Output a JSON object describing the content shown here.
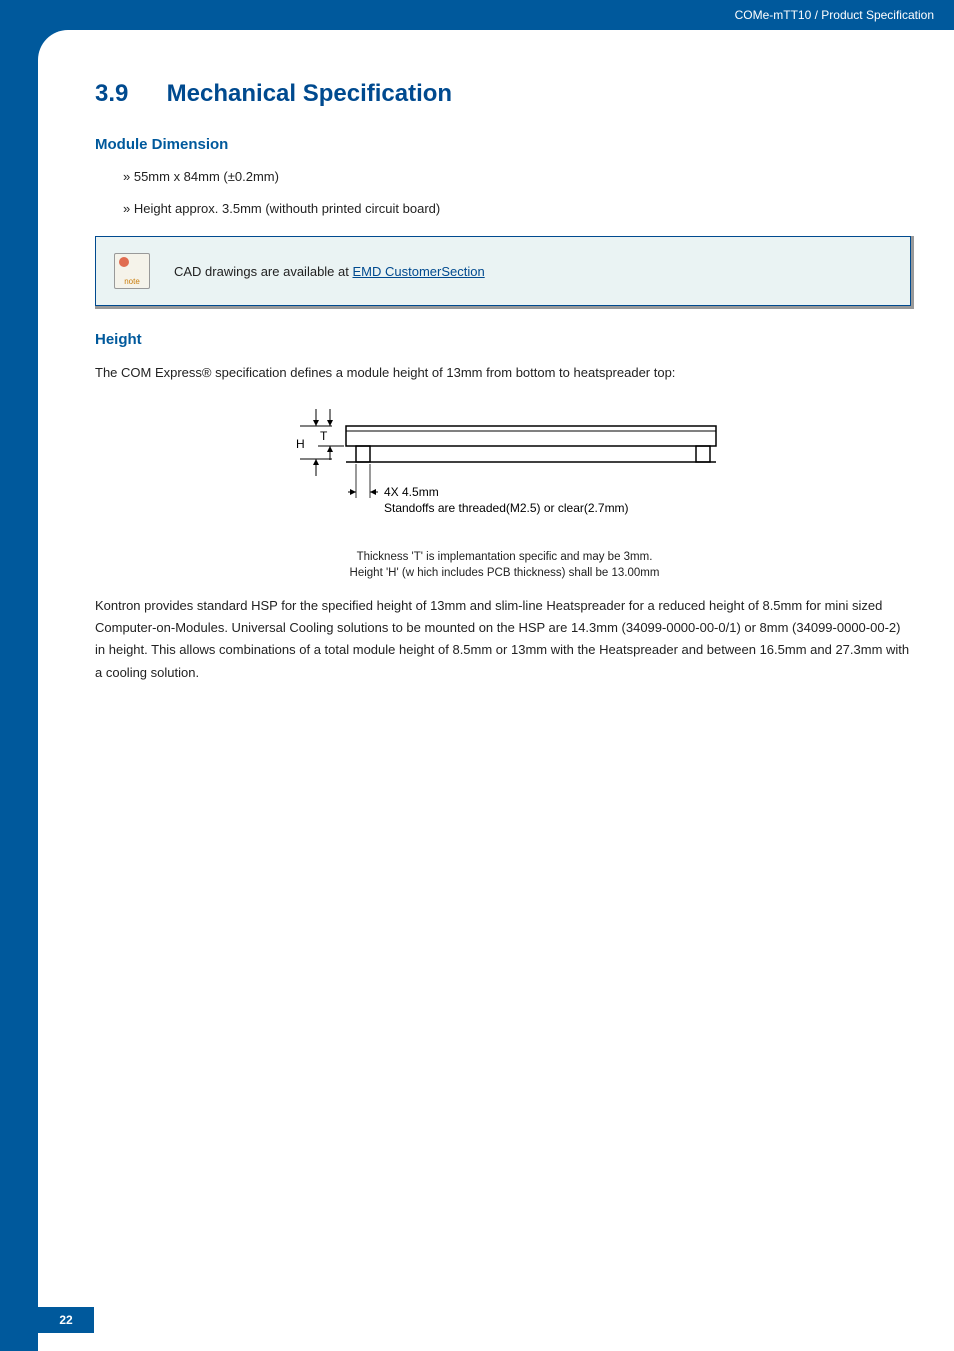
{
  "header": {
    "breadcrumb": "COMe-mTT10 / Product Specification"
  },
  "section": {
    "number": "3.9",
    "title": "Mechanical Specification"
  },
  "module_dimension": {
    "heading": "Module Dimension",
    "bullets": [
      "» 55mm x 84mm (±0.2mm)",
      "» Height approx. 3.5mm (withouth printed circuit board)"
    ]
  },
  "note": {
    "icon_label": "note",
    "text_prefix": "CAD drawings are available at ",
    "link_text": "EMD CustomerSection"
  },
  "height_section": {
    "heading": "Height",
    "intro": "The COM Express® specification defines a module height of 13mm from bottom to heatspreader top:",
    "body": " Kontron provides standard HSP for the specified height of 13mm and slim-line Heatspreader for a reduced height of 8.5mm for mini sized Computer-on-Modules. Universal Cooling solutions to be mounted on the HSP are 14.3mm (34099-0000-00-0/1) or 8mm (34099-0000-00-2) in height. This allows combinations of a total module height of 8.5mm or 13mm with the Heatspreader and between 16.5mm and 27.3mm with a cooling solution."
  },
  "figure": {
    "label_h": "H",
    "label_t": "T",
    "standoff_label": "4X 4.5mm",
    "standoff_desc": "Standoffs are threaded(M2.5) or clear(2.7mm)",
    "caption_line1": "Thickness 'T' is implemantation specific and may be 3mm.",
    "caption_line2": "Height 'H' (w hich includes PCB thickness) shall be 13.00mm"
  },
  "page_number": "22"
}
